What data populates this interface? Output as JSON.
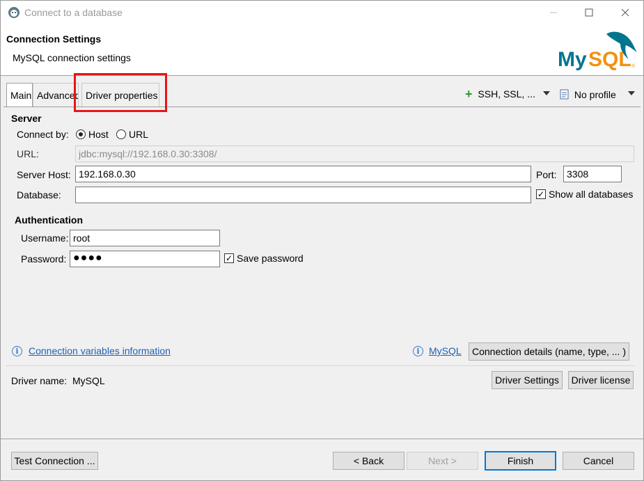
{
  "window": {
    "title": "Connect to a database",
    "minimize_icon": "minimize-icon",
    "maximize_icon": "maximize-icon",
    "close_icon": "close-icon"
  },
  "header": {
    "title": "Connection Settings",
    "subtitle": "MySQL connection settings",
    "logo_text": "MySQL"
  },
  "tabs": [
    {
      "label": "Main"
    },
    {
      "label": "Advanced"
    },
    {
      "label": "Driver properties"
    }
  ],
  "toolbar": {
    "network_label": "SSH, SSL, ...",
    "profile_label": "No profile"
  },
  "server": {
    "section_label": "Server",
    "connect_by_label": "Connect by:",
    "host_option": "Host",
    "url_option": "URL",
    "connect_by_selected": "Host",
    "url_label": "URL:",
    "url_value": "jdbc:mysql://192.168.0.30:3308/",
    "host_label": "Server Host:",
    "host_value": "192.168.0.30",
    "port_label": "Port:",
    "port_value": "3308",
    "database_label": "Database:",
    "database_value": "",
    "show_all_label": "Show all databases",
    "show_all_checked": true
  },
  "auth": {
    "section_label": "Authentication",
    "username_label": "Username:",
    "username_value": "root",
    "password_label": "Password:",
    "password_value": "●●●●",
    "save_password_label": "Save password",
    "save_password_checked": true
  },
  "footer_links": {
    "variables_link": "Connection variables information",
    "mysql_link": "MySQL",
    "details_button": "Connection details (name, type, ... )"
  },
  "driver": {
    "name_label": "Driver name:",
    "name_value": "MySQL",
    "settings_button": "Driver Settings",
    "license_button": "Driver license"
  },
  "buttons": {
    "test": "Test Connection ...",
    "back": "< Back",
    "next": "Next >",
    "finish": "Finish",
    "cancel": "Cancel"
  },
  "colors": {
    "highlight": "#e8141a",
    "link": "#1f5fb3",
    "mysql_blue": "#00758f",
    "mysql_orange": "#f29111"
  }
}
